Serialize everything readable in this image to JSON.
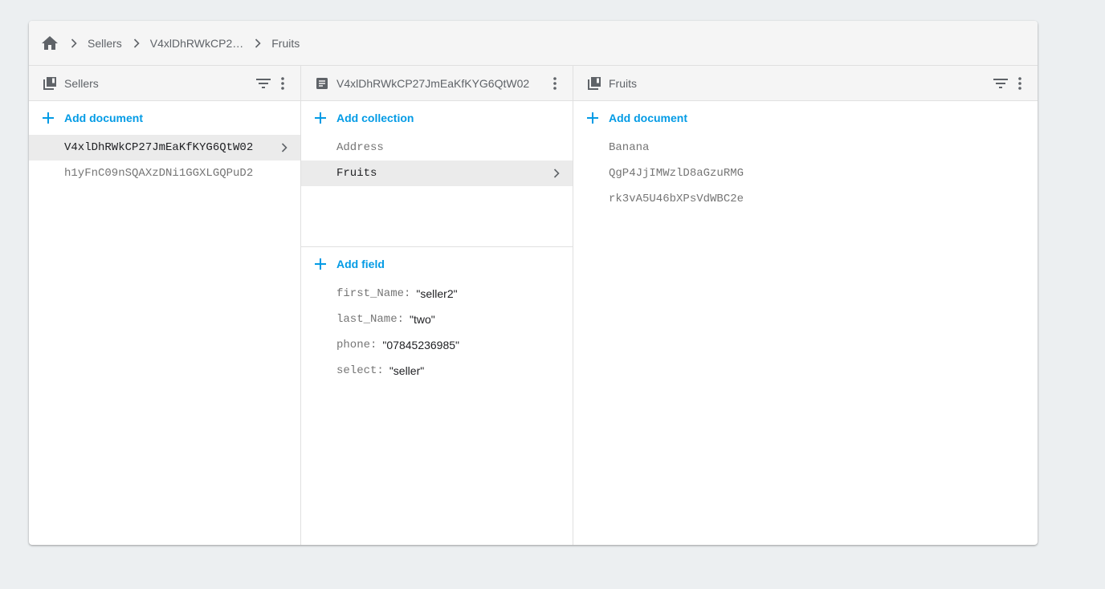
{
  "breadcrumb": {
    "home_icon": "home-icon",
    "items": [
      "Sellers",
      "V4xlDhRWkCP2…",
      "Fruits"
    ]
  },
  "columns": {
    "collection": {
      "title": "Sellers",
      "icon": "collection-icon",
      "add_label": "Add document",
      "items": [
        {
          "label": "V4xlDhRWkCP27JmEaKfKYG6QtW02",
          "selected": true
        },
        {
          "label": "h1yFnC09nSQAXzDNi1GGXLGQPuD2",
          "selected": false
        }
      ]
    },
    "document": {
      "title": "V4xlDhRWkCP27JmEaKfKYG6QtW02",
      "icon": "document-icon",
      "add_collection_label": "Add collection",
      "collections": [
        {
          "label": "Address",
          "selected": false
        },
        {
          "label": "Fruits",
          "selected": true
        }
      ],
      "add_field_label": "Add field",
      "fields": [
        {
          "key": "first_Name:",
          "value": "\"seller2\""
        },
        {
          "key": "last_Name:",
          "value": "\"two\""
        },
        {
          "key": "phone:",
          "value": "\"07845236985\""
        },
        {
          "key": "select:",
          "value": "\"seller\""
        }
      ]
    },
    "subcollection": {
      "title": "Fruits",
      "icon": "collection-icon",
      "add_label": "Add document",
      "items": [
        {
          "label": "Banana"
        },
        {
          "label": "QgP4JjIMWzlD8aGzuRMG"
        },
        {
          "label": "rk3vA5U46bXPsVdWBC2e"
        }
      ]
    }
  },
  "colors": {
    "accent": "#039be5",
    "header_bg": "#f5f5f5",
    "selected_bg": "#ebebeb",
    "page_bg": "#eceff1"
  }
}
